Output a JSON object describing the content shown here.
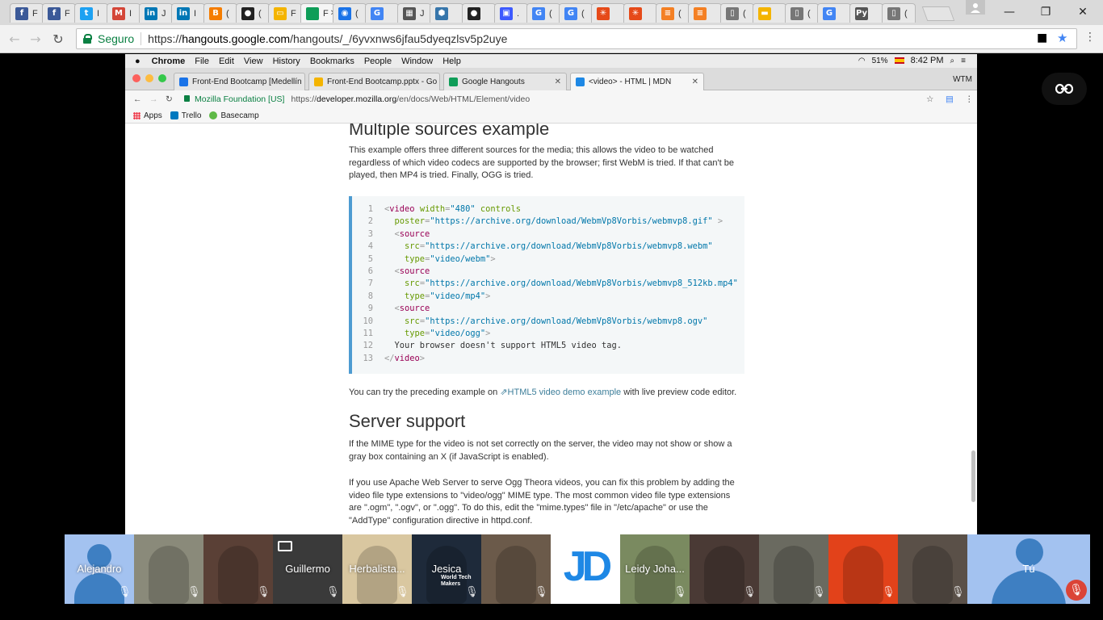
{
  "outer_tabs": [
    {
      "icon": "facebook-icon",
      "glyph": "f",
      "color": "#3b5998",
      "label": "F"
    },
    {
      "icon": "facebook-icon",
      "glyph": "f",
      "color": "#3b5998",
      "label": "F"
    },
    {
      "icon": "twitter-icon",
      "glyph": "t",
      "color": "#1da1f2",
      "label": "I"
    },
    {
      "icon": "gmail-icon",
      "glyph": "M",
      "color": "#d44638",
      "label": "I"
    },
    {
      "icon": "linkedin-icon",
      "glyph": "in",
      "color": "#0077b5",
      "label": "J"
    },
    {
      "icon": "linkedin-icon",
      "glyph": "in",
      "color": "#0077b5",
      "label": "I"
    },
    {
      "icon": "blogger-icon",
      "glyph": "B",
      "color": "#f57d00",
      "label": "("
    },
    {
      "icon": "github-icon",
      "glyph": "●",
      "color": "#222222",
      "label": "("
    },
    {
      "icon": "slides-icon",
      "glyph": "▭",
      "color": "#f4b400",
      "label": "F"
    },
    {
      "icon": "hangouts-icon",
      "glyph": "",
      "color": "#0f9d58",
      "label": "F",
      "active": true
    },
    {
      "icon": "chrome-app-icon",
      "glyph": "◉",
      "color": "#1a73e8",
      "label": "("
    },
    {
      "icon": "google-icon",
      "glyph": "G",
      "color": "#4285f4",
      "label": ""
    },
    {
      "icon": "sheet-icon",
      "glyph": "▦",
      "color": "#555555",
      "label": "J"
    },
    {
      "icon": "python-icon",
      "glyph": "⬢",
      "color": "#3776ab",
      "label": ""
    },
    {
      "icon": "github-icon",
      "glyph": "●",
      "color": "#222222",
      "label": ""
    },
    {
      "icon": "app-icon",
      "glyph": "▣",
      "color": "#3d5afe",
      "label": "."
    },
    {
      "icon": "google-icon",
      "glyph": "G",
      "color": "#4285f4",
      "label": "("
    },
    {
      "icon": "google-icon",
      "glyph": "G",
      "color": "#4285f4",
      "label": "("
    },
    {
      "icon": "app-icon",
      "glyph": "✳",
      "color": "#e64a19",
      "label": ""
    },
    {
      "icon": "app-icon",
      "glyph": "✳",
      "color": "#e64a19",
      "label": ""
    },
    {
      "icon": "stackoverflow-icon",
      "glyph": "≡",
      "color": "#f48024",
      "label": "("
    },
    {
      "icon": "stackoverflow-icon",
      "glyph": "≡",
      "color": "#f48024",
      "label": ""
    },
    {
      "icon": "document-icon",
      "glyph": "▯",
      "color": "#777777",
      "label": "("
    },
    {
      "icon": "image-icon",
      "glyph": "▬",
      "color": "#f4b400",
      "label": ""
    },
    {
      "icon": "document-icon",
      "glyph": "▯",
      "color": "#777777",
      "label": "("
    },
    {
      "icon": "google-icon",
      "glyph": "G",
      "color": "#4285f4",
      "label": ""
    },
    {
      "icon": "app-icon",
      "glyph": "Py",
      "color": "#555555",
      "label": ""
    },
    {
      "icon": "document-icon",
      "glyph": "▯",
      "color": "#777777",
      "label": "("
    }
  ],
  "outer_toolbar": {
    "secure_label": "Seguro",
    "url_prefix": "https://",
    "url_host": "hangouts.google.com",
    "url_path": "/hangouts/_/6yvxnws6jfau5dyeqzlsv5p2uye"
  },
  "mac_menu": {
    "app": "Chrome",
    "items": [
      "File",
      "Edit",
      "View",
      "History",
      "Bookmarks",
      "People",
      "Window",
      "Help"
    ],
    "battery": "51%",
    "time": "8:42 PM"
  },
  "inner_tabs": [
    {
      "label": "Front-End Bootcamp [Medellín",
      "color": "#1a73e8"
    },
    {
      "label": "Front-End Bootcamp.pptx - Go",
      "color": "#f4b400"
    },
    {
      "label": "Google Hangouts",
      "color": "#0f9d58"
    },
    {
      "label": "<video> - HTML | MDN",
      "color": "#1e88e5",
      "active": true
    }
  ],
  "inner_profile": "WTM",
  "inner_toolbar": {
    "org": "Mozilla Foundation [US]",
    "url_prefix": "https://",
    "url_host": "developer.mozilla.org",
    "url_path": "/en/docs/Web/HTML/Element/video"
  },
  "bookmarks": [
    "Apps",
    "Trello",
    "Basecamp"
  ],
  "page": {
    "heading1": "Multiple sources example",
    "intro": "This example offers three different sources for the media; this allows the video to be watched regardless of which video codecs are supported by the browser; first WebM is tried. If that can't be played, then MP4 is tried. Finally, OGG is tried.",
    "try_before": "You can try the preceding example on ",
    "try_link": "HTML5 video demo example",
    "try_after": " with live preview code editor.",
    "heading2": "Server support",
    "server_p1": "If the MIME type for the video is not set correctly on the server, the video may not show or show a gray box containing an X (if JavaScript is enabled).",
    "server_p2": "If you use Apache Web Server to serve Ogg Theora videos, you can fix this problem by adding the video file type extensions to \"video/ogg\" MIME type. The most common video file type extensions are \".ogm\", \".ogv\", or \".ogg\". To do this, edit the \"mime.types\" file in \"/etc/apache\" or use the \"AddType\" configuration directive in httpd.conf."
  },
  "code_lines": [
    {
      "n": "1",
      "parts": [
        [
          "punc",
          "<"
        ],
        [
          "tag",
          "video"
        ],
        [
          "plain",
          " "
        ],
        [
          "attr",
          "width"
        ],
        [
          "punc",
          "="
        ],
        [
          "str",
          "\"480\""
        ],
        [
          "plain",
          " "
        ],
        [
          "attr",
          "controls"
        ]
      ]
    },
    {
      "n": "2",
      "parts": [
        [
          "plain",
          "  "
        ],
        [
          "attr",
          "poster"
        ],
        [
          "punc",
          "="
        ],
        [
          "str",
          "\"https://archive.org/download/WebmVp8Vorbis/webmvp8.gif\""
        ],
        [
          "plain",
          " "
        ],
        [
          "punc",
          ">"
        ]
      ]
    },
    {
      "n": "3",
      "parts": [
        [
          "plain",
          "  "
        ],
        [
          "punc",
          "<"
        ],
        [
          "tag",
          "source"
        ]
      ]
    },
    {
      "n": "4",
      "parts": [
        [
          "plain",
          "    "
        ],
        [
          "attr",
          "src"
        ],
        [
          "punc",
          "="
        ],
        [
          "str",
          "\"https://archive.org/download/WebmVp8Vorbis/webmvp8.webm\""
        ]
      ]
    },
    {
      "n": "5",
      "parts": [
        [
          "plain",
          "    "
        ],
        [
          "attr",
          "type"
        ],
        [
          "punc",
          "="
        ],
        [
          "str",
          "\"video/webm\""
        ],
        [
          "punc",
          ">"
        ]
      ]
    },
    {
      "n": "6",
      "parts": [
        [
          "plain",
          "  "
        ],
        [
          "punc",
          "<"
        ],
        [
          "tag",
          "source"
        ]
      ]
    },
    {
      "n": "7",
      "parts": [
        [
          "plain",
          "    "
        ],
        [
          "attr",
          "src"
        ],
        [
          "punc",
          "="
        ],
        [
          "str",
          "\"https://archive.org/download/WebmVp8Vorbis/webmvp8_512kb.mp4\""
        ]
      ]
    },
    {
      "n": "8",
      "parts": [
        [
          "plain",
          "    "
        ],
        [
          "attr",
          "type"
        ],
        [
          "punc",
          "="
        ],
        [
          "str",
          "\"video/mp4\""
        ],
        [
          "punc",
          ">"
        ]
      ]
    },
    {
      "n": "9",
      "parts": [
        [
          "plain",
          "  "
        ],
        [
          "punc",
          "<"
        ],
        [
          "tag",
          "source"
        ]
      ]
    },
    {
      "n": "10",
      "parts": [
        [
          "plain",
          "    "
        ],
        [
          "attr",
          "src"
        ],
        [
          "punc",
          "="
        ],
        [
          "str",
          "\"https://archive.org/download/WebmVp8Vorbis/webmvp8.ogv\""
        ]
      ]
    },
    {
      "n": "11",
      "parts": [
        [
          "plain",
          "    "
        ],
        [
          "attr",
          "type"
        ],
        [
          "punc",
          "="
        ],
        [
          "str",
          "\"video/ogg\""
        ],
        [
          "punc",
          ">"
        ]
      ]
    },
    {
      "n": "12",
      "parts": [
        [
          "plain",
          "  Your browser doesn't support HTML5 video tag."
        ]
      ]
    },
    {
      "n": "13",
      "parts": [
        [
          "punc",
          "</"
        ],
        [
          "tag",
          "video"
        ],
        [
          "punc",
          ">"
        ]
      ]
    }
  ],
  "participants": [
    {
      "name": "Alejandro",
      "kind": "avatar",
      "bg": "#a3c2f0"
    },
    {
      "name": "",
      "kind": "photo",
      "bg": "#8a8a7a"
    },
    {
      "name": "",
      "kind": "photo",
      "bg": "#5a4036"
    },
    {
      "name": "Guillermo",
      "kind": "screen",
      "bg": "#3a3a3a"
    },
    {
      "name": "Herbalista...",
      "kind": "photo",
      "bg": "#d9c7a0"
    },
    {
      "name": "Jesica",
      "kind": "photo",
      "bg": "#1e2a3a",
      "sub": "World Tech Makers"
    },
    {
      "name": "",
      "kind": "photo",
      "bg": "#6b5a4a"
    },
    {
      "name": "",
      "kind": "logo",
      "bg": "#ffffff",
      "logo": "JD"
    },
    {
      "name": "Leidy Joha...",
      "kind": "photo",
      "bg": "#7a8a60"
    },
    {
      "name": "",
      "kind": "photo",
      "bg": "#4a3a35"
    },
    {
      "name": "",
      "kind": "photo",
      "bg": "#6a6a60"
    },
    {
      "name": "",
      "kind": "photo",
      "bg": "#e2421a"
    },
    {
      "name": "",
      "kind": "photo",
      "bg": "#5a5048"
    }
  ],
  "self": {
    "name": "Tú"
  },
  "colors": {
    "accent": "#4d9bd1",
    "link": "#3d7e9a",
    "secure": "#0b8043",
    "mute_red": "#db4437"
  }
}
